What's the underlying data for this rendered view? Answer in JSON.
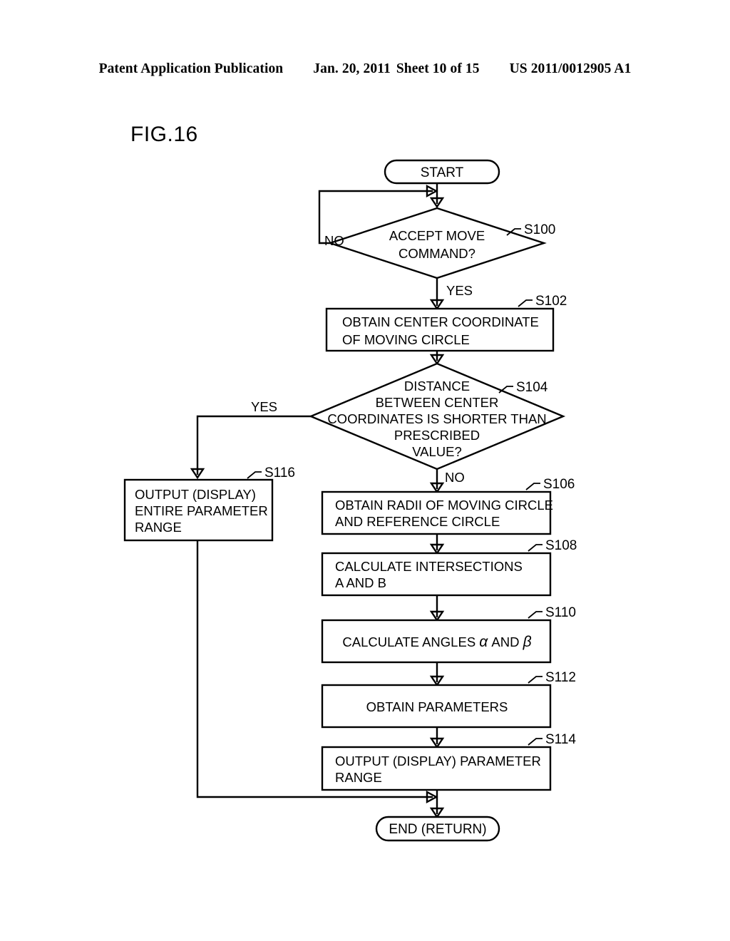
{
  "header": {
    "publication": "Patent Application Publication",
    "date": "Jan. 20, 2011",
    "sheet": "Sheet 10 of 15",
    "doc_number": "US 2011/0012905 A1"
  },
  "figure": {
    "label": "FIG.16"
  },
  "diagram": {
    "type": "flowchart",
    "terminals": {
      "start": "START",
      "end": "END (RETURN)"
    },
    "branch_labels": {
      "s100_no": "NO",
      "s100_yes": "YES",
      "s104_yes": "YES",
      "s104_no": "NO"
    },
    "nodes": [
      {
        "id": "S100",
        "shape": "decision",
        "lines": [
          "ACCEPT MOVE",
          "COMMAND?"
        ]
      },
      {
        "id": "S102",
        "shape": "process",
        "lines": [
          "OBTAIN CENTER COORDINATE",
          "OF MOVING CIRCLE"
        ]
      },
      {
        "id": "S104",
        "shape": "decision",
        "lines": [
          "DISTANCE",
          "BETWEEN CENTER",
          "COORDINATES IS SHORTER THAN",
          "PRESCRIBED",
          "VALUE?"
        ]
      },
      {
        "id": "S116",
        "shape": "process",
        "lines": [
          "OUTPUT (DISPLAY)",
          "ENTIRE PARAMETER",
          "RANGE"
        ]
      },
      {
        "id": "S106",
        "shape": "process",
        "lines": [
          "OBTAIN RADII OF MOVING CIRCLE",
          "AND REFERENCE CIRCLE"
        ]
      },
      {
        "id": "S108",
        "shape": "process",
        "lines": [
          "CALCULATE INTERSECTIONS",
          "A AND B"
        ]
      },
      {
        "id": "S110",
        "shape": "process",
        "lines": [
          "CALCULATE ANGLES α AND β"
        ],
        "prefix": "CALCULATE ANGLES",
        "greek_1": "α",
        "middle": "AND",
        "greek_2": "β"
      },
      {
        "id": "S112",
        "shape": "process",
        "lines": [
          "OBTAIN PARAMETERS"
        ]
      },
      {
        "id": "S114",
        "shape": "process",
        "lines": [
          "OUTPUT (DISPLAY) PARAMETER",
          "RANGE"
        ]
      }
    ]
  },
  "colors": {
    "ink": "#000000",
    "paper": "#ffffff"
  }
}
